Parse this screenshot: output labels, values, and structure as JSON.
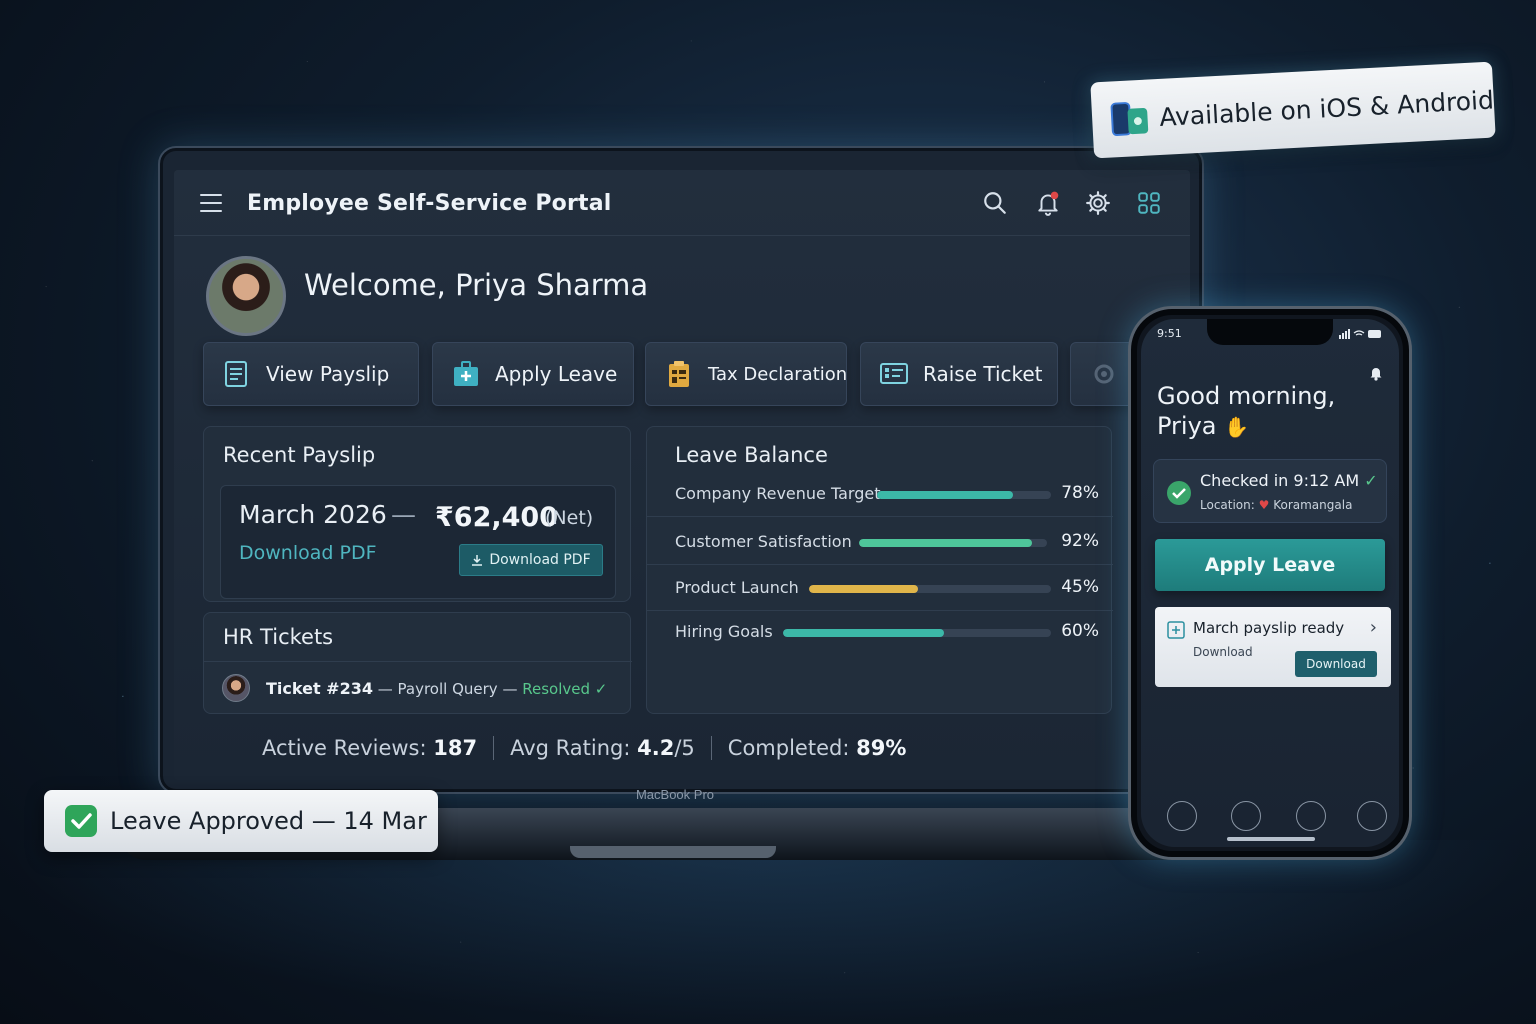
{
  "floating": {
    "platform_badge": "Available on iOS & Android",
    "leave_badge": "Leave Approved — 14 Mar"
  },
  "laptop": {
    "model_label": "MacBook Pro",
    "header": {
      "title": "Employee Self-Service Portal"
    },
    "welcome": "Welcome, Priya Sharma",
    "actions": [
      "View Payslip",
      "Apply Leave",
      "Tax Declaration",
      "Raise Ticket"
    ],
    "payslip": {
      "title": "Recent Payslip",
      "month": "March 2026",
      "separator": "—",
      "amount": "₹62,400",
      "net_label": "(Net)",
      "link": "Download PDF",
      "button": "Download PDF"
    },
    "tickets": {
      "title": "HR Tickets",
      "id": "Ticket #234",
      "dash1": "—",
      "topic": "Payroll Query",
      "dash2": "—",
      "status": "Resolved"
    },
    "leave_balance": {
      "title": "Leave Balance",
      "items": [
        {
          "label": "Company Revenue Target",
          "percent": 78,
          "display": "78%",
          "color": "#3cb8a8"
        },
        {
          "label": "Customer Satisfaction",
          "percent": 92,
          "display": "92%",
          "color": "#4ec59a"
        },
        {
          "label": "Product Launch",
          "percent": 45,
          "display": "45%",
          "color": "#e0b54a"
        },
        {
          "label": "Hiring Goals",
          "percent": 60,
          "display": "60%",
          "color": "#3cb8a8"
        }
      ]
    },
    "stats": {
      "reviews_label": "Active Reviews:",
      "reviews_value": "187",
      "rating_label": "Avg Rating:",
      "rating_value": "4.2",
      "rating_suffix": "/5",
      "completed_label": "Completed:",
      "completed_value": "89%"
    }
  },
  "phone": {
    "time": "9:51",
    "greeting_line1": "Good morning,",
    "greeting_line2": "Priya",
    "checkin": "Checked in 9:12 AM",
    "location_label": "Location:",
    "location_value": "Koramangala",
    "apply_button": "Apply Leave",
    "notice_title": "March payslip ready",
    "notice_sub": "Download",
    "notice_button": "Download"
  },
  "colors": {
    "accent_teal": "#2b9a98",
    "success_green": "#58c78c",
    "warning_gold": "#e0b54a"
  }
}
